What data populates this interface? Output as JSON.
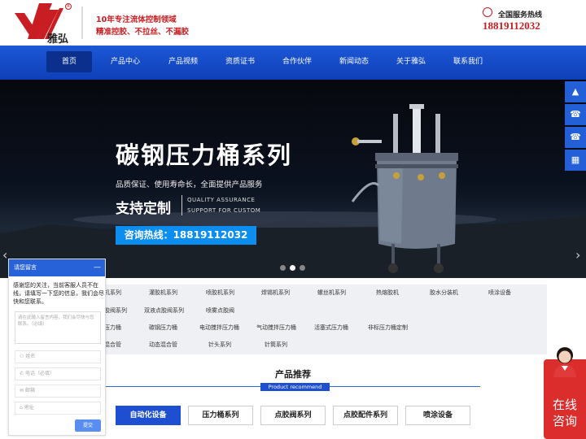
{
  "header": {
    "slogan_line1": "10年专注流体控制领域",
    "slogan_line2": "精准控胶、不拉丝、不漏胶",
    "hotline_label": "全国服务热线",
    "hotline_number": "18819112032",
    "logo_text": "雅弘"
  },
  "nav": {
    "items": [
      "首页",
      "产品中心",
      "产品视频",
      "资质证书",
      "合作伙伴",
      "新闻动态",
      "关于雅弘",
      "联系我们"
    ],
    "active_index": 0
  },
  "banner": {
    "title": "碳钢压力桶系列",
    "subtitle": "品质保证、使用寿命长，全面提供产品服务",
    "bold_text": "支持定制",
    "eng_line1": "QUALITY ASSURANCE",
    "eng_line2": "SUPPORT FOR CUSTOM",
    "cta": "咨询热线：18819112032",
    "slide_count": 3,
    "active_slide": 1
  },
  "categories": {
    "row1": [
      "机系列",
      "灌胶机系列",
      "喷胶机系列",
      "焊锡机系列",
      "螺丝机系列",
      "热熔胶机",
      "胶水分装机",
      "喷涂设备"
    ],
    "row2": [
      "胶阀系列",
      "双液点胶阀系列",
      "喷雾点胶阀"
    ],
    "row3": [
      "压力桶",
      "碳钢压力桶",
      "电动搅拌压力桶",
      "气动搅拌压力桶",
      "活塞式压力桶",
      "非标压力桶定制"
    ],
    "row4": [
      "混合管",
      "动态混合管",
      "针头系列",
      "针筒系列"
    ]
  },
  "products": {
    "title": "产品推荐",
    "subtitle_en": "Product recommend",
    "tabs": [
      "自动化设备",
      "压力桶系列",
      "点胶阀系列",
      "点胶配件系列",
      "喷涂设备"
    ],
    "active_tab": 0
  },
  "chat": {
    "header": "请您留言",
    "minimize": "—",
    "intro": "感谢您的关注，当前客服人员不在线，请填写一下您的信息，我们会尽快和您联系。",
    "textarea_placeholder": "请在此输入留言内容，我们会尽快与您联系。（必填）",
    "name_placeholder": "姓名",
    "phone_placeholder": "电话（必填）",
    "email_placeholder": "邮箱",
    "address_placeholder": "地址",
    "submit": "提交"
  },
  "online": {
    "label_line1": "在线",
    "label_line2": "咨询"
  },
  "side_tools": {
    "icons": [
      "arrow-up-icon",
      "phone-icon",
      "phone-icon",
      "qrcode-icon"
    ]
  },
  "colors": {
    "nav_blue": "#1c58d6",
    "brand_red": "#c81d22",
    "cta_blue": "#0c8df0"
  }
}
